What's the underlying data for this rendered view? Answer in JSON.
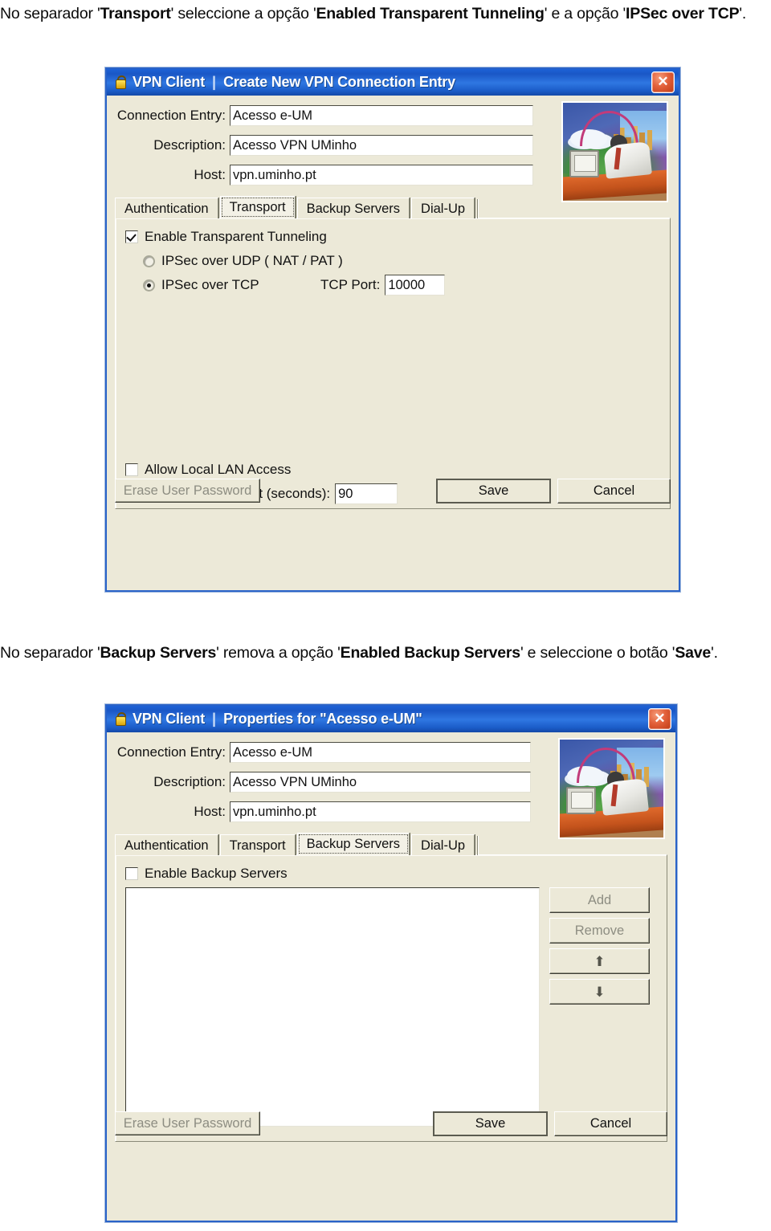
{
  "instructions": {
    "line1": {
      "p1": "No separador '",
      "b1": "Transport",
      "p2": "' seleccione a opção '",
      "b2": "Enabled Transparent Tunneling",
      "p3": "' e a opção '",
      "b3": "IPSec over TCP",
      "p4": "'."
    },
    "line2": {
      "p1": "No separador '",
      "b1": "Backup Servers",
      "p2": "' remova a opção '",
      "b2": "Enabled Backup Servers",
      "p3": "' e seleccione o botão '",
      "b3": "Save",
      "p4": "'."
    }
  },
  "dialog1": {
    "title_app": "VPN Client",
    "title_sep": "|",
    "title_doc": "Create New VPN Connection Entry",
    "close_label": "✕",
    "fields": [
      {
        "label": "Connection Entry:",
        "value": "Acesso e-UM"
      },
      {
        "label": "Description:",
        "value": "Acesso VPN UMinho"
      },
      {
        "label": "Host:",
        "value": "vpn.uminho.pt"
      }
    ],
    "tabs": [
      {
        "label": "Authentication",
        "selected": false
      },
      {
        "label": "Transport",
        "selected": true
      },
      {
        "label": "Backup Servers",
        "selected": false
      },
      {
        "label": "Dial-Up",
        "selected": false
      }
    ],
    "transport": {
      "enable_tunneling_label": "Enable Transparent Tunneling",
      "enable_tunneling_checked": "true",
      "radio_udp_label": "IPSec over UDP ( NAT / PAT )",
      "radio_udp_selected": "false",
      "radio_tcp_label": "IPSec over TCP",
      "radio_tcp_selected": "true",
      "tcp_port_label": "TCP Port:",
      "tcp_port_value": "10000",
      "allow_lan_label": "Allow Local LAN Access",
      "allow_lan_checked": "false",
      "peer_timeout_label": "Peer response timeout (seconds):",
      "peer_timeout_value": "90"
    },
    "footer": {
      "erase_label": "Erase User Password",
      "save_label": "Save",
      "cancel_label": "Cancel"
    }
  },
  "dialog2": {
    "title_app": "VPN Client",
    "title_sep": "|",
    "title_doc": "Properties for \"Acesso e-UM\"",
    "close_label": "✕",
    "fields": [
      {
        "label": "Connection Entry:",
        "value": "Acesso e-UM"
      },
      {
        "label": "Description:",
        "value": "Acesso VPN UMinho"
      },
      {
        "label": "Host:",
        "value": "vpn.uminho.pt"
      }
    ],
    "tabs": [
      {
        "label": "Authentication",
        "selected": false
      },
      {
        "label": "Transport",
        "selected": false
      },
      {
        "label": "Backup Servers",
        "selected": true
      },
      {
        "label": "Dial-Up",
        "selected": false
      }
    ],
    "backup": {
      "enable_backup_label": "Enable Backup Servers",
      "enable_backup_checked": "false",
      "list_items": [],
      "add_label": "Add",
      "remove_label": "Remove",
      "move_up_label": "⬆",
      "move_down_label": "⬇"
    },
    "footer": {
      "erase_label": "Erase User Password",
      "save_label": "Save",
      "cancel_label": "Cancel"
    }
  },
  "colors": {
    "titlebar_blue": "#1d62d6",
    "dialog_face": "#ece9d8",
    "dialog_border": "#2a63c8",
    "close_red": "#c8431a"
  }
}
